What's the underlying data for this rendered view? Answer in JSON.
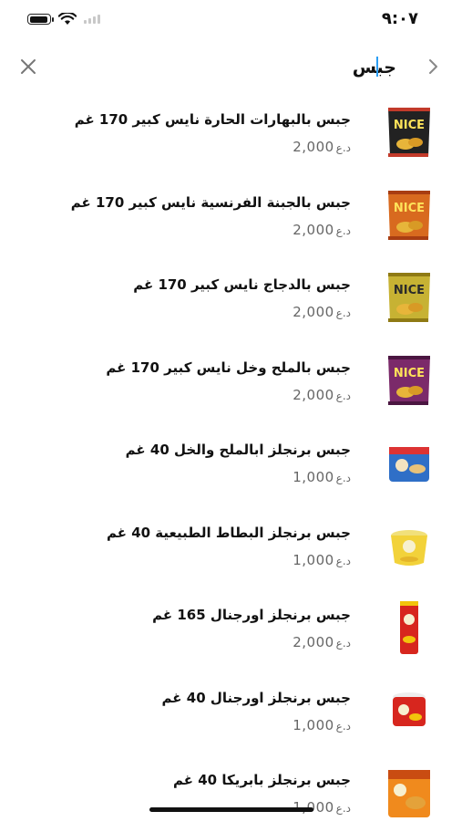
{
  "status_bar": {
    "time": "٩:٠٧",
    "battery_level": 0.95
  },
  "search": {
    "value": "جبس",
    "close_icon": "close-icon",
    "back_icon": "chevron-right-icon"
  },
  "results": [
    {
      "name": "جبس بالبهارات الحارة نايس كبير 170 غم",
      "price": "2,000",
      "currency": "د.ع",
      "thumb": "nice-red-bag"
    },
    {
      "name": "جبس بالجبنة الفرنسية نايس كبير 170 غم",
      "price": "2,000",
      "currency": "د.ع",
      "thumb": "nice-orange-bag"
    },
    {
      "name": "جبس بالدجاج نايس كبير 170 غم",
      "price": "2,000",
      "currency": "د.ع",
      "thumb": "nice-yellow-bag"
    },
    {
      "name": "جبس بالملح وخل نايس كبير 170 غم",
      "price": "2,000",
      "currency": "د.ع",
      "thumb": "nice-purple-bag"
    },
    {
      "name": "جبس برنجلز ابالملح والخل 40 غم",
      "price": "1,000",
      "currency": "د.ع",
      "thumb": "pringles-blue-cup"
    },
    {
      "name": "جبس برنجلز البطاط الطبيعية 40 غم",
      "price": "1,000",
      "currency": "د.ع",
      "thumb": "pringles-yellow-cup"
    },
    {
      "name": "جبس برنجلز اورجنال 165 غم",
      "price": "2,000",
      "currency": "د.ع",
      "thumb": "pringles-red-can"
    },
    {
      "name": "جبس برنجلز اورجنال 40 غم",
      "price": "1,000",
      "currency": "د.ع",
      "thumb": "pringles-red-cup"
    },
    {
      "name": "جبس برنجلز بابريكا  40 غم",
      "price": "1,000",
      "currency": "د.ع",
      "thumb": "pringles-orange-box"
    }
  ]
}
